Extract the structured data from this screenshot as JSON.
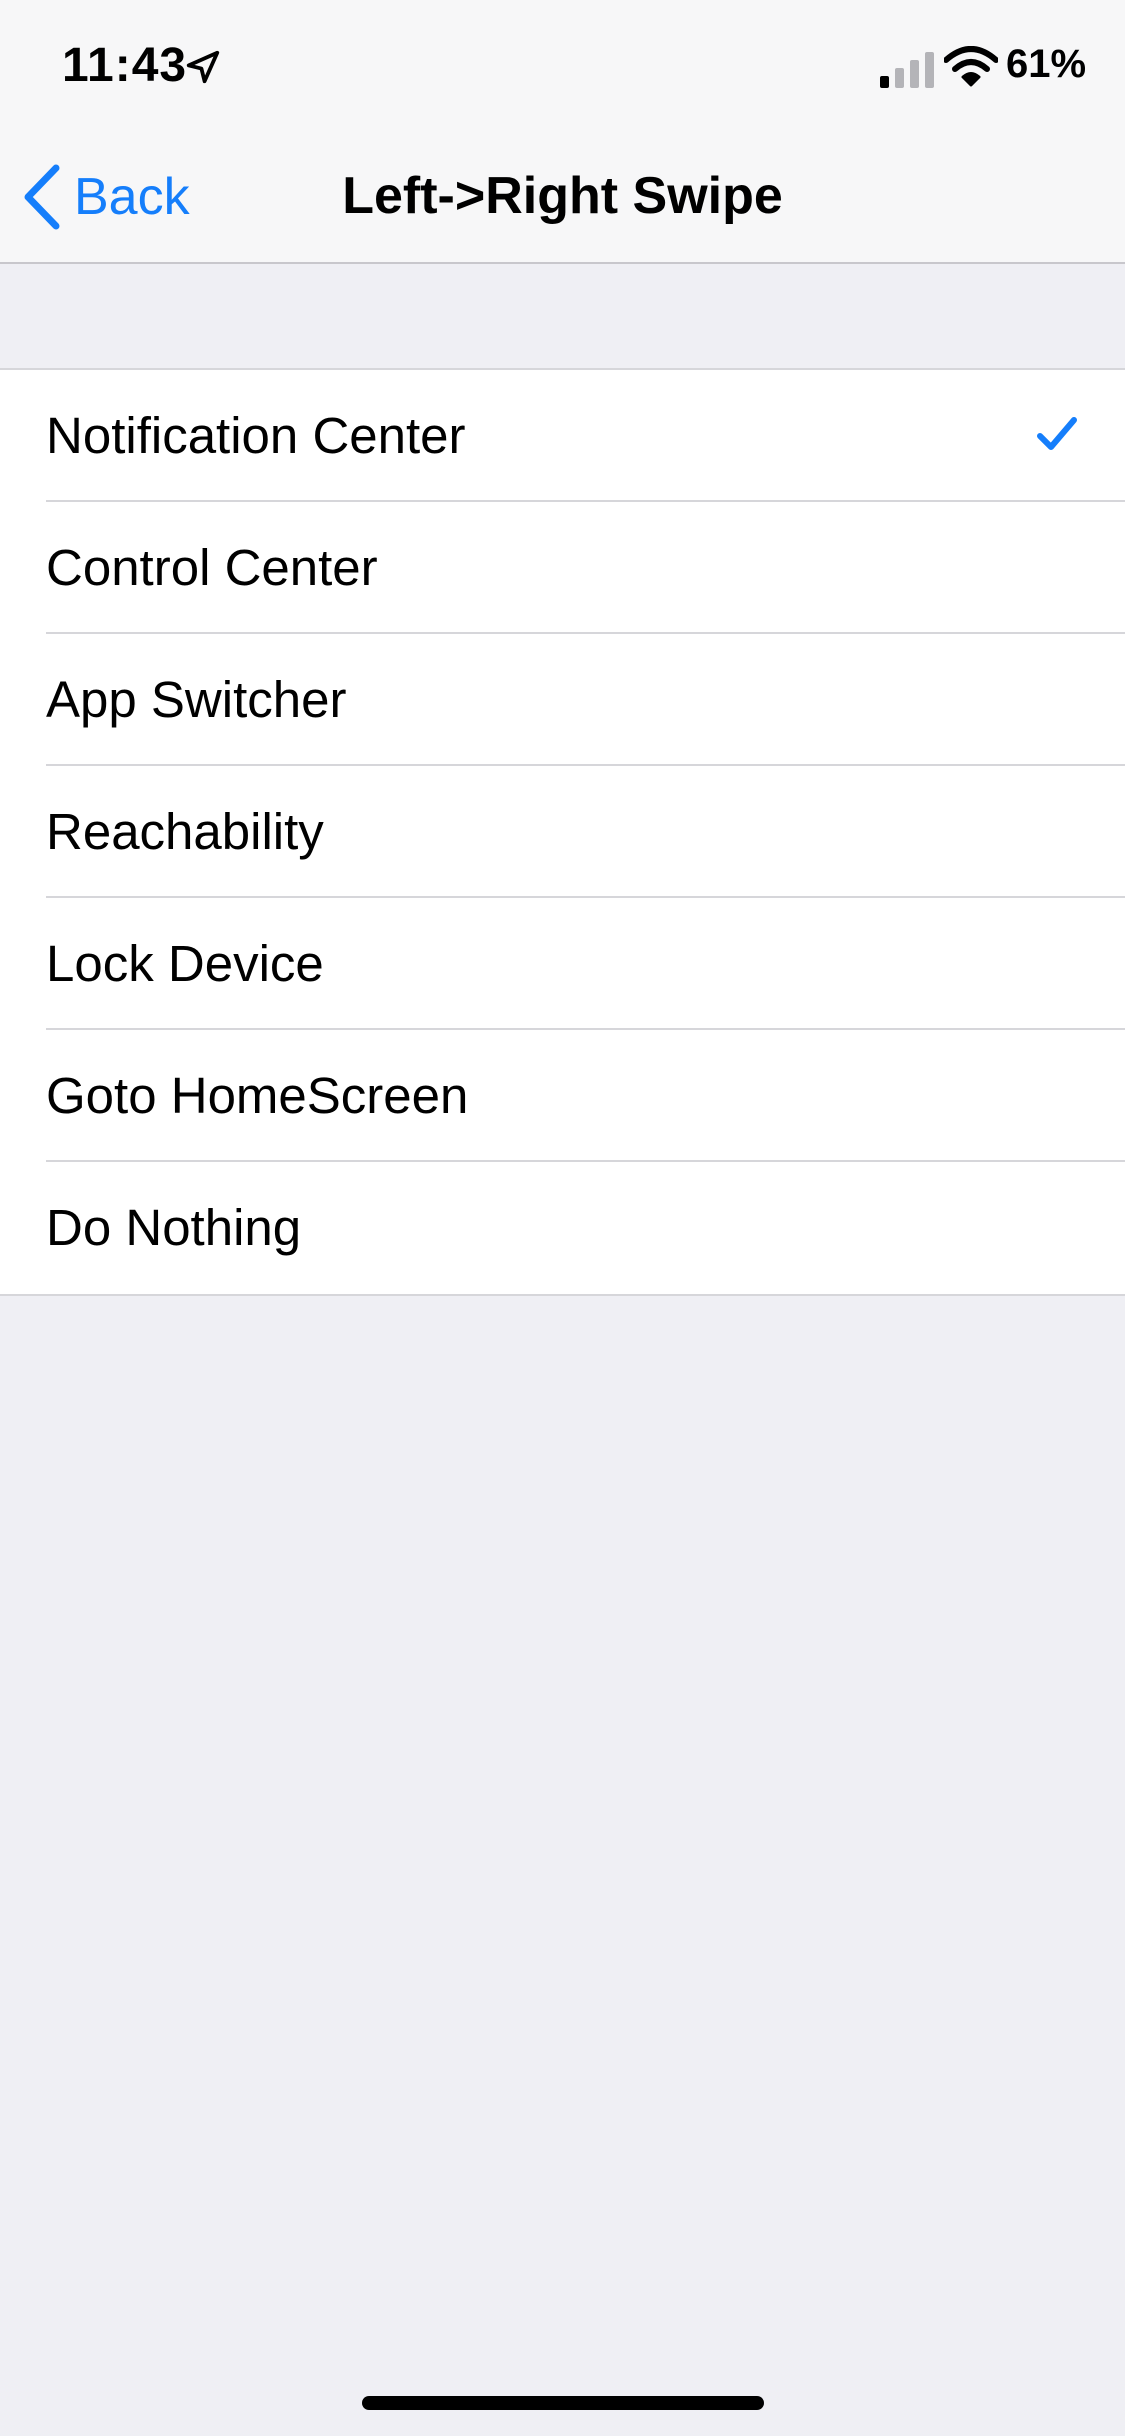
{
  "status_bar": {
    "time": "11:43",
    "battery": "61%"
  },
  "nav": {
    "back_label": "Back",
    "title": "Left->Right Swipe"
  },
  "options": [
    {
      "label": "Notification Center",
      "selected": true
    },
    {
      "label": "Control Center",
      "selected": false
    },
    {
      "label": "App Switcher",
      "selected": false
    },
    {
      "label": "Reachability",
      "selected": false
    },
    {
      "label": "Lock Device",
      "selected": false
    },
    {
      "label": "Goto HomeScreen",
      "selected": false
    },
    {
      "label": "Do Nothing",
      "selected": false
    }
  ],
  "colors": {
    "accent": "#157efb",
    "background": "#efeff4",
    "bar": "#f7f7f8"
  },
  "icons": {
    "back": "chevron-left-icon",
    "selected": "checkmark-icon",
    "location": "location-arrow-icon",
    "signal": "cellular-signal-icon",
    "wifi": "wifi-icon"
  }
}
